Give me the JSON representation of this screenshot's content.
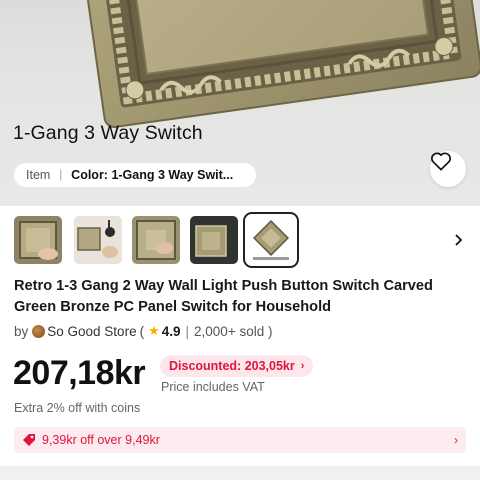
{
  "product_header": {
    "variant_title": "1-Gang 3 Way Switch",
    "item_label": "Item",
    "color_label": "Color: 1-Gang 3 Way Swit..."
  },
  "icons": {
    "favorite": "heart-outline-icon",
    "next": "chevron-right-icon",
    "coupon": "price-tag-icon"
  },
  "thumbnails": [
    {
      "name": "thumbnail-1",
      "selected": false
    },
    {
      "name": "thumbnail-2",
      "selected": false
    },
    {
      "name": "thumbnail-3",
      "selected": false
    },
    {
      "name": "thumbnail-4",
      "selected": false
    },
    {
      "name": "thumbnail-5",
      "selected": true
    }
  ],
  "product": {
    "title": "Retro 1-3 Gang 2 Way Wall Light Push Button Switch Carved Green Bronze PC Panel Switch for Household",
    "by_label": "by",
    "store_name": "So Good Store",
    "open_paren": "(",
    "rating": "4.9",
    "sold": "2,000+ sold )",
    "price": "207,18kr",
    "discounted": "Discounted: 203,05kr",
    "vat_note": "Price includes VAT",
    "coins_note": "Extra 2% off with coins",
    "coupon_text": "9,39kr off over 9,49kr"
  },
  "colors": {
    "accent_red": "#e0153d",
    "badge_bg": "#fde7ec",
    "star": "#f5b400"
  }
}
